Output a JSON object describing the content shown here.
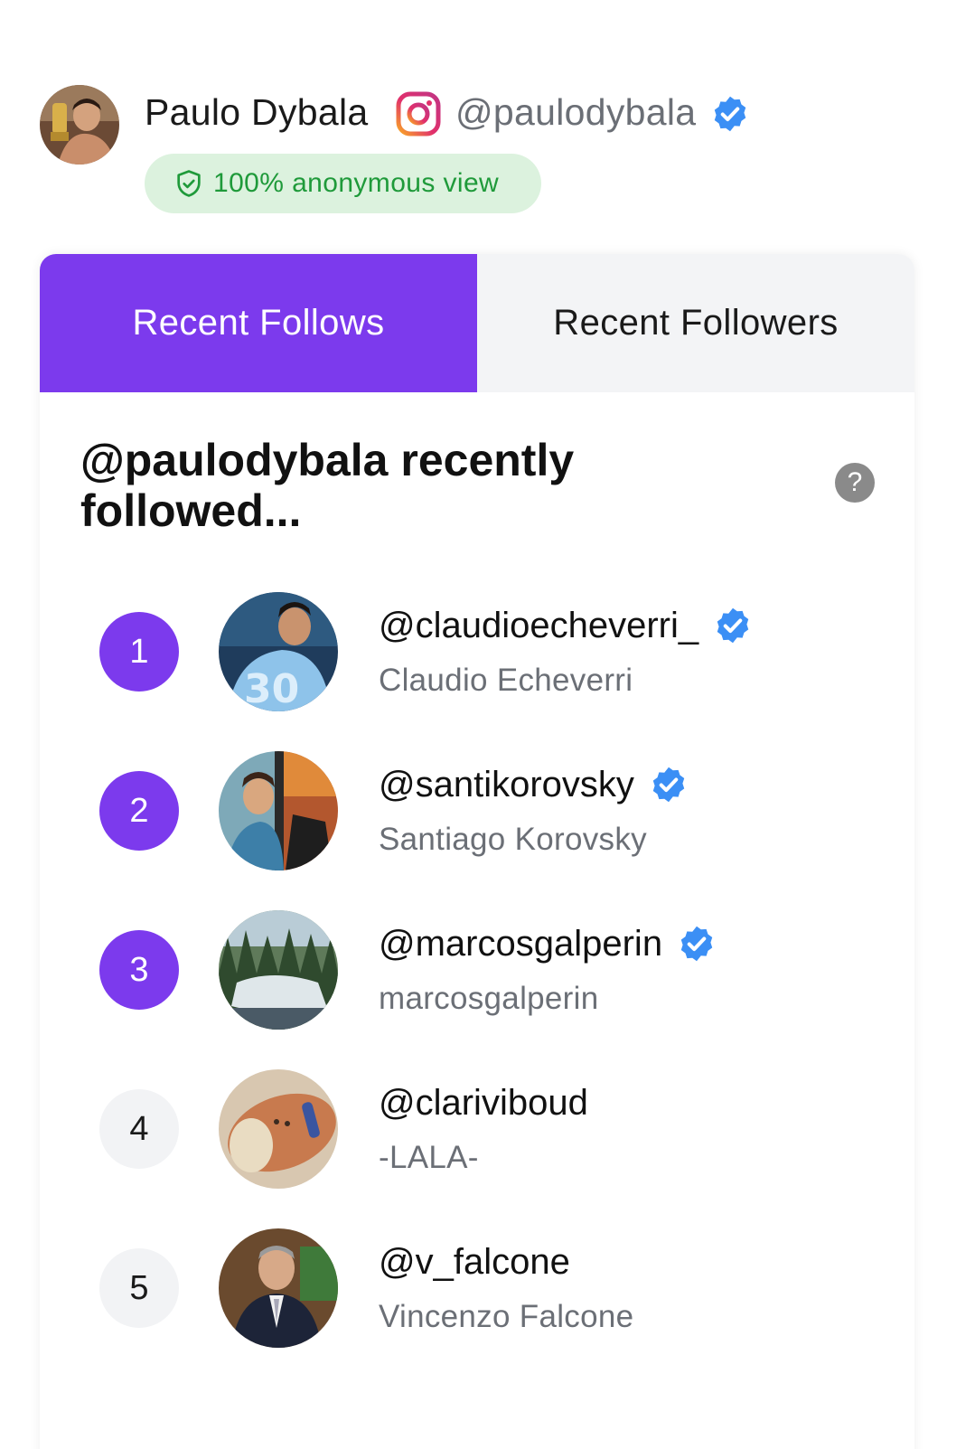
{
  "profile": {
    "name": "Paulo Dybala",
    "handle": "@paulodybala",
    "verified": true,
    "badge_label": "100% anonymous view",
    "badge_color": "#1f9a3a"
  },
  "tabs": [
    {
      "label": "Recent Follows",
      "active": true
    },
    {
      "label": "Recent Followers",
      "active": false
    }
  ],
  "section_title": "@paulodybala recently followed...",
  "help_label": "?",
  "accounts": [
    {
      "rank": "1",
      "handle": "@claudioecheverri_",
      "name": "Claudio Echeverri",
      "verified": true
    },
    {
      "rank": "2",
      "handle": "@santikorovsky",
      "name": "Santiago Korovsky",
      "verified": true
    },
    {
      "rank": "3",
      "handle": "@marcosgalperin",
      "name": "marcosgalperin",
      "verified": true
    },
    {
      "rank": "4",
      "handle": "@clariviboud",
      "name": "-LALA-",
      "verified": false
    },
    {
      "rank": "5",
      "handle": "@v_falcone",
      "name": "Vincenzo Falcone",
      "verified": false
    }
  ],
  "colors": {
    "accent": "#7c3aed",
    "verified_blue": "#3b8ff5",
    "muted_text": "#6b6f76",
    "badge_bg": "#dcf2de"
  },
  "icons": {
    "platform": "instagram-icon",
    "verified": "verified-badge-icon",
    "shield": "shield-check-icon",
    "help": "question-mark-icon"
  }
}
